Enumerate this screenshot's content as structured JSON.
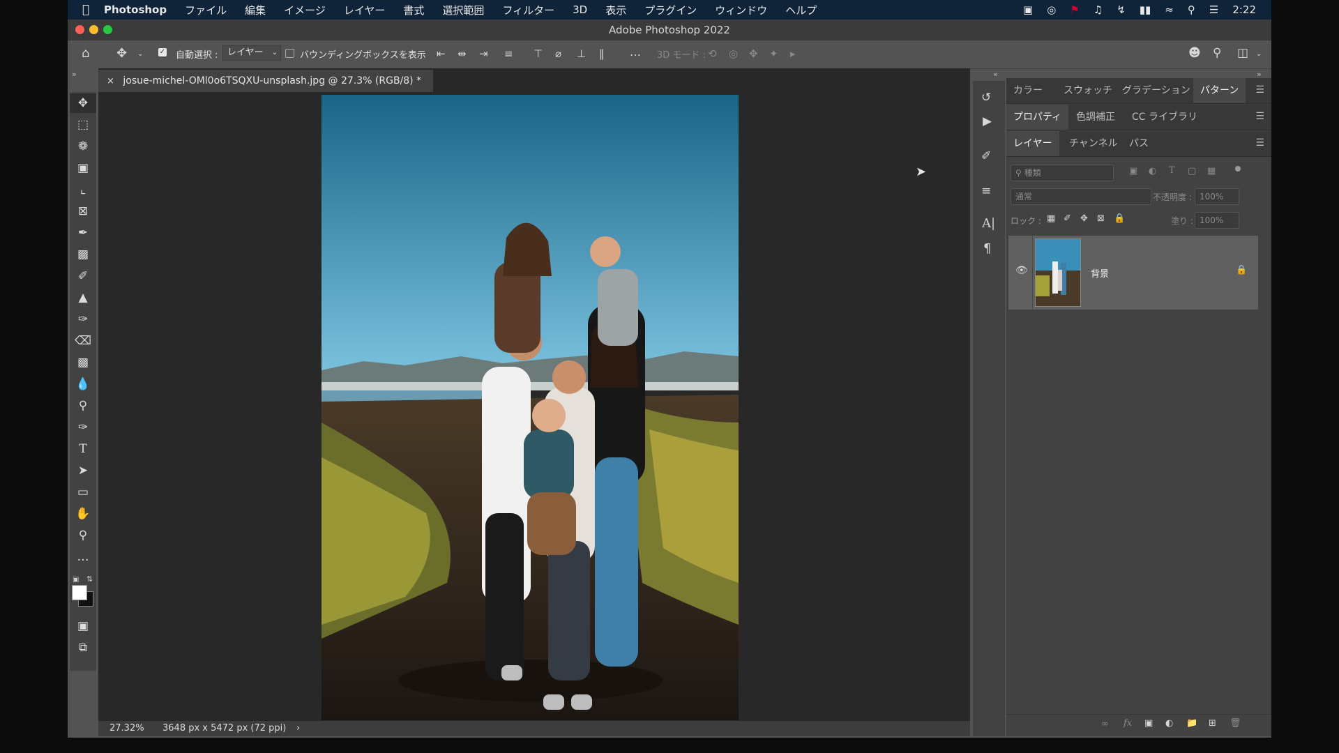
{
  "menubar": {
    "apple": "",
    "app_name": "Photoshop",
    "items": [
      "ファイル",
      "編集",
      "イメージ",
      "レイヤー",
      "書式",
      "選択範囲",
      "フィルター",
      "3D",
      "表示",
      "プラグイン",
      "ウィンドウ",
      "ヘルプ"
    ],
    "clock": "2:22"
  },
  "window": {
    "title": "Adobe Photoshop 2022"
  },
  "options": {
    "auto_select_label": "自動選択 :",
    "auto_select_value": "レイヤー",
    "bounding_box_label": "バウンディングボックスを表示",
    "mode_3d_label": "3D モード :"
  },
  "document": {
    "tab_title": "josue-michel-OMl0o6TSQXU-unsplash.jpg @ 27.3% (RGB/8) *",
    "close_glyph": "×"
  },
  "status": {
    "zoom": "27.32%",
    "size": "3648 px x 5472 px (72 ppi)",
    "arrow": "›"
  },
  "panels": {
    "row1_tabs": [
      "カラー",
      "スウォッチ",
      "グラデーション",
      "パターン"
    ],
    "row2_tabs": [
      "プロパティ",
      "色調補正",
      "CC ライブラリ"
    ],
    "row3_tabs": [
      "レイヤー",
      "チャンネル",
      "パス"
    ],
    "filter_placeholder": "種類",
    "blend_mode": "通常",
    "opacity_label": "不透明度 :",
    "opacity_value": "100%",
    "lock_label": "ロック :",
    "fill_label": "塗り :",
    "fill_value": "100%",
    "layer_name": "背景"
  },
  "colors": {
    "menubar_bg": "#0f2438",
    "panel_bg": "#424242",
    "canvas_bg": "#282828",
    "sky_top": "#1a6588",
    "sky_bottom": "#7ec6e2"
  }
}
